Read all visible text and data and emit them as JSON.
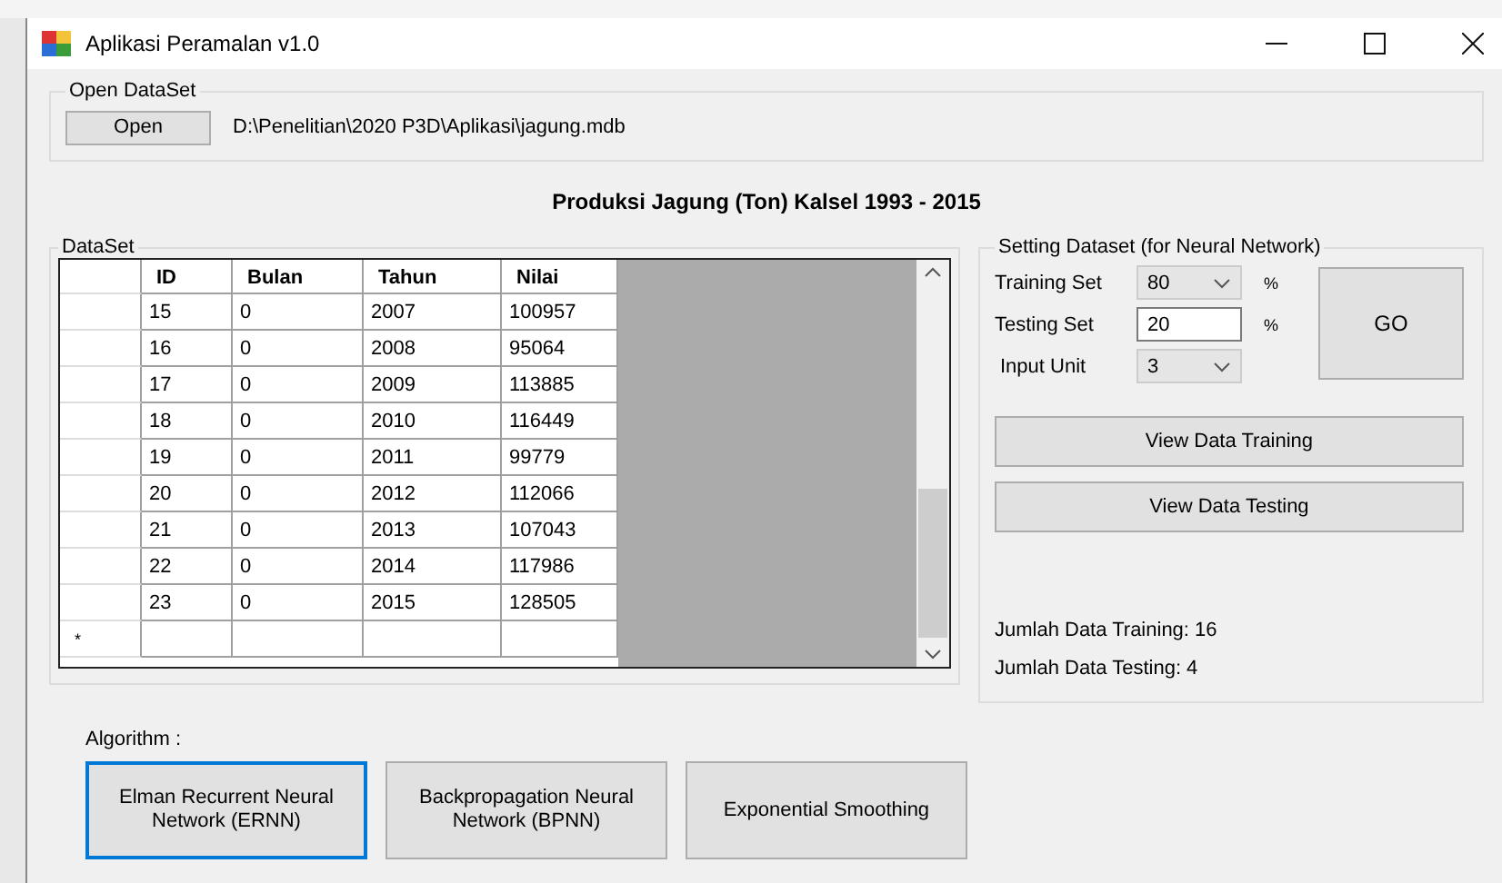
{
  "window": {
    "title": "Aplikasi Peramalan v1.0"
  },
  "open_dataset": {
    "title": "Open DataSet",
    "button": "Open",
    "path": "D:\\Penelitian\\2020 P3D\\Aplikasi\\jagung.mdb"
  },
  "heading": "Produksi Jagung (Ton) Kalsel 1993 - 2015",
  "dataset": {
    "title": "DataSet",
    "columns": [
      "ID",
      "Bulan",
      "Tahun",
      "Nilai"
    ],
    "rows": [
      [
        "15",
        "0",
        "2007",
        "100957"
      ],
      [
        "16",
        "0",
        "2008",
        "95064"
      ],
      [
        "17",
        "0",
        "2009",
        "113885"
      ],
      [
        "18",
        "0",
        "2010",
        "116449"
      ],
      [
        "19",
        "0",
        "2011",
        "99779"
      ],
      [
        "20",
        "0",
        "2012",
        "112066"
      ],
      [
        "21",
        "0",
        "2013",
        "107043"
      ],
      [
        "22",
        "0",
        "2014",
        "117986"
      ],
      [
        "23",
        "0",
        "2015",
        "128505"
      ]
    ],
    "new_row_marker": "*"
  },
  "settings": {
    "title": "Setting Dataset (for Neural Network)",
    "fields": [
      {
        "label": "Training Set",
        "kind": "dropdown",
        "value": "80",
        "unit": "%"
      },
      {
        "label": "Testing Set",
        "kind": "textbox",
        "value": "20",
        "unit": "%"
      },
      {
        "label": "Input Unit",
        "kind": "dropdown",
        "value": "3"
      }
    ],
    "go_button": "GO",
    "buttons": [
      "View Data Training",
      "View Data Testing"
    ],
    "info": [
      "Jumlah Data Training: 16",
      "Jumlah Data Testing: 4"
    ]
  },
  "algorithm": {
    "label": "Algorithm :",
    "buttons": [
      {
        "label": "Elman Recurrent Neural Network (ERNN)",
        "focused": true
      },
      {
        "label": "Backpropagation Neural Network (BPNN)",
        "focused": false
      },
      {
        "label": "Exponential Smoothing",
        "focused": false
      }
    ]
  }
}
